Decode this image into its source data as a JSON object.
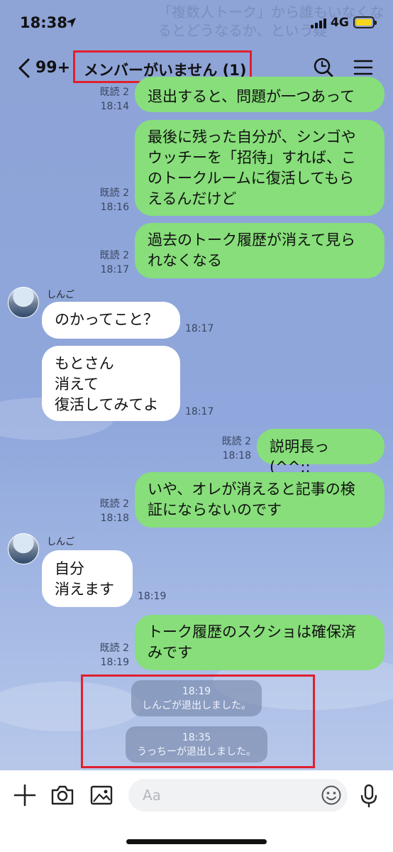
{
  "status_bar": {
    "time": "18:38",
    "network": "4G"
  },
  "background_overlay_text": "「複数人トーク」から誰もいなくなるとどうなるか、という疑",
  "header": {
    "unread_count": "99+",
    "title": "メンバーがいません (1)"
  },
  "messages": [
    {
      "side": "out",
      "read": "既読 2",
      "time": "18:14",
      "lines": [
        "退出すると、問題が一つあって"
      ]
    },
    {
      "side": "out",
      "read": "既読 2",
      "time": "18:16",
      "lines": [
        "最後に残った自分が、シンゴや",
        "ウッチーを「招待」すれば、こ",
        "のトークルームに復活してもら",
        "えるんだけど"
      ]
    },
    {
      "side": "out",
      "read": "既読 2",
      "time": "18:17",
      "lines": [
        "過去のトーク履歴が消えて見ら",
        "れなくなる"
      ]
    },
    {
      "side": "in",
      "sender": "しんご",
      "time": "18:17",
      "lines": [
        "のかってこと？"
      ]
    },
    {
      "side": "in",
      "time": "18:17",
      "lines": [
        "もとさん",
        "消えて",
        "復活してみてよ"
      ]
    },
    {
      "side": "out",
      "read": "既読 2",
      "time": "18:18",
      "lines": [
        "説明長っ (^^;;"
      ]
    },
    {
      "side": "out",
      "read": "既読 2",
      "time": "18:18",
      "lines": [
        "いや、オレが消えると記事の検",
        "証にならないのです"
      ]
    },
    {
      "side": "in",
      "sender": "しんご",
      "time": "18:19",
      "lines": [
        "自分",
        "消えます"
      ]
    },
    {
      "side": "out",
      "read": "既読 2",
      "time": "18:19",
      "lines": [
        "トーク履歴のスクショは確保済",
        "みです"
      ]
    }
  ],
  "system_messages": [
    {
      "time": "18:19",
      "text": "しんごが退出しました。"
    },
    {
      "time": "18:35",
      "text": "うっちーが退出しました。"
    }
  ],
  "input": {
    "placeholder": "Aa"
  },
  "icons": {
    "back": "chevron-left-icon",
    "search": "search-icon",
    "menu": "menu-icon",
    "add": "plus-icon",
    "camera": "camera-icon",
    "image": "image-icon",
    "emoji": "emoji-icon",
    "mic": "microphone-icon"
  },
  "colors": {
    "background": "#8fa5d8",
    "outgoing_bubble": "#87de7a",
    "incoming_bubble": "#ffffff",
    "highlight_box": "#e0202f",
    "battery": "#f7d61b"
  }
}
